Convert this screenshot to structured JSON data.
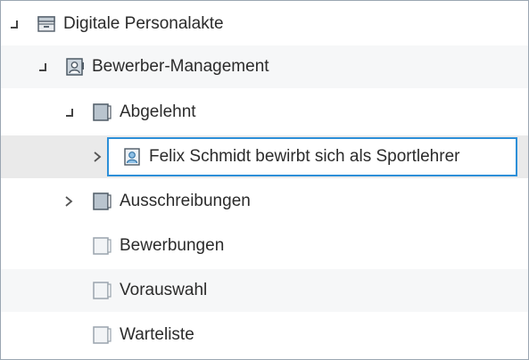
{
  "tree": {
    "root": {
      "label": "Digitale Personalakte",
      "icon": "cabinet-icon",
      "toggle": "expanded"
    },
    "management": {
      "label": "Bewerber-Management",
      "icon": "person-folder-icon",
      "toggle": "expanded"
    },
    "abgelehnt": {
      "label": "Abgelehnt",
      "icon": "folder-icon",
      "toggle": "expanded"
    },
    "felix": {
      "label": "Felix Schmidt bewirbt sich als Sportlehrer",
      "icon": "person-file-icon",
      "toggle": "collapsed",
      "selected": true
    },
    "ausschreibungen": {
      "label": "Ausschreibungen",
      "icon": "folder-icon",
      "toggle": "collapsed"
    },
    "bewerbungen": {
      "label": "Bewerbungen",
      "icon": "empty-folder-icon"
    },
    "vorauswahl": {
      "label": "Vorauswahl",
      "icon": "empty-folder-icon"
    },
    "warteliste": {
      "label": "Warteliste",
      "icon": "empty-folder-icon"
    }
  },
  "colors": {
    "selection_border": "#2d8fd8",
    "row_alt": "#f6f7f8",
    "row_hover": "#eaeaea"
  }
}
